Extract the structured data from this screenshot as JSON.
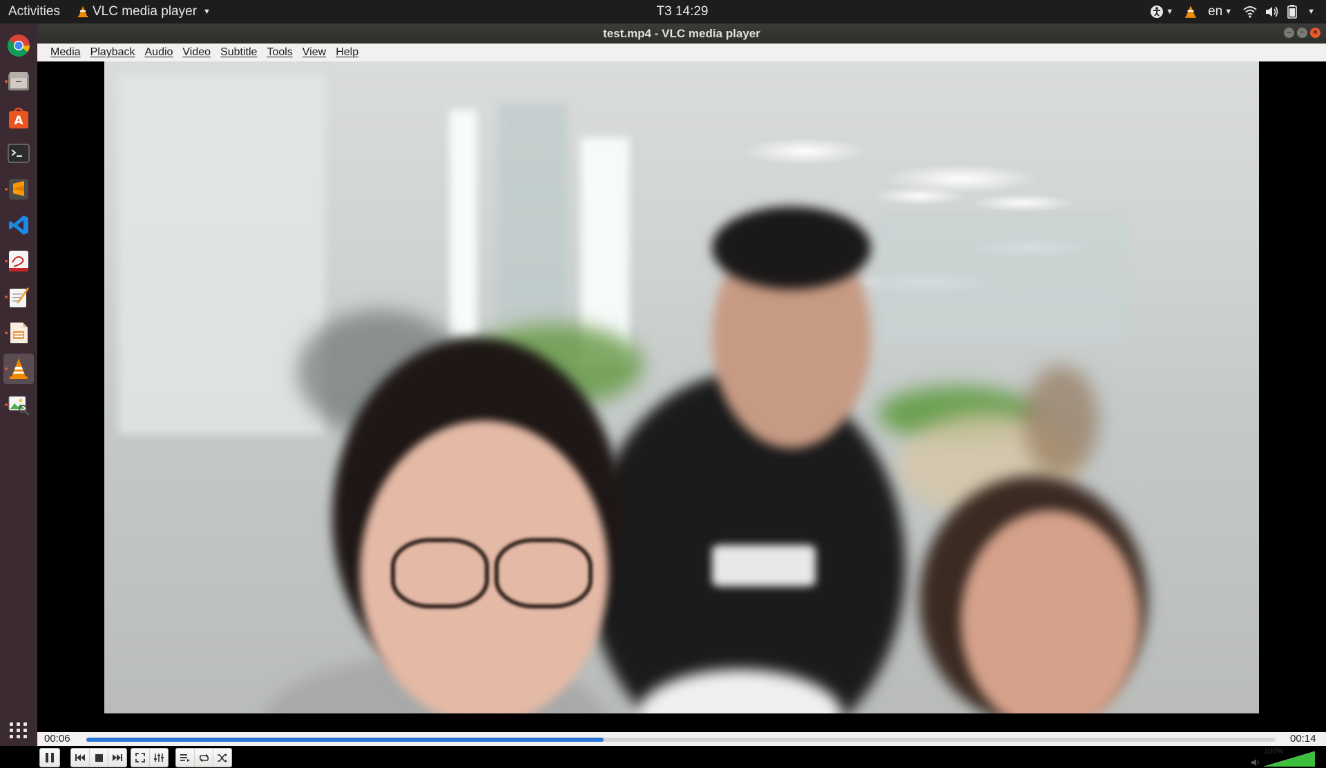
{
  "topbar": {
    "activities": "Activities",
    "app_name": "VLC media player",
    "clock": "T3 14:29",
    "language": "en"
  },
  "dock": {
    "items": [
      "chrome-icon",
      "files-icon",
      "software-center-icon",
      "terminal-icon",
      "sublime-text-icon",
      "vscode-icon",
      "xournal-icon",
      "text-editor-icon",
      "document-viewer-icon",
      "vlc-icon",
      "image-viewer-icon"
    ]
  },
  "window": {
    "title": "test.mp4 - VLC media player"
  },
  "menu": {
    "items": [
      "Media",
      "Playback",
      "Audio",
      "Video",
      "Subtitle",
      "Tools",
      "View",
      "Help"
    ]
  },
  "player": {
    "elapsed": "00:06",
    "total": "00:14",
    "progress": 0.435,
    "volume_label": "100%",
    "volume_level": 1.0,
    "state": "playing"
  },
  "colors": {
    "accent": "#2a78d6",
    "ubuntu_orange": "#e95420",
    "dock_bg": "#3c2a32",
    "topbar_bg": "#1d1d1d"
  }
}
